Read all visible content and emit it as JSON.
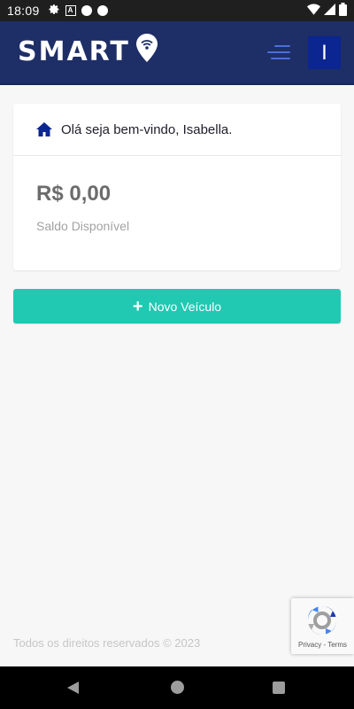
{
  "status_bar": {
    "time": "18:09"
  },
  "header": {
    "brand": "SMART",
    "avatar_initial": "I"
  },
  "welcome_card": {
    "greeting": "Olá seja bem-vindo, Isabella.",
    "balance": "R$ 0,00",
    "balance_label": "Saldo Disponível"
  },
  "actions": {
    "new_vehicle_label": "Novo Veículo"
  },
  "footer": {
    "text": "Todos os direitos reservados © 2023"
  },
  "recaptcha": {
    "privacy": "Privacy",
    "separator": "-",
    "terms": "Terms"
  },
  "colors": {
    "header_bg": "#1e2e67",
    "accent": "#21c8b2",
    "avatar_bg": "#0b2591"
  },
  "icons": [
    "settings-icon",
    "a-icon",
    "wifi-icon",
    "signal-icon",
    "battery-icon",
    "location-pin-icon",
    "menu-icon",
    "home-icon",
    "plus-icon",
    "recaptcha-icon",
    "back-icon",
    "home-nav-icon",
    "recents-icon"
  ]
}
